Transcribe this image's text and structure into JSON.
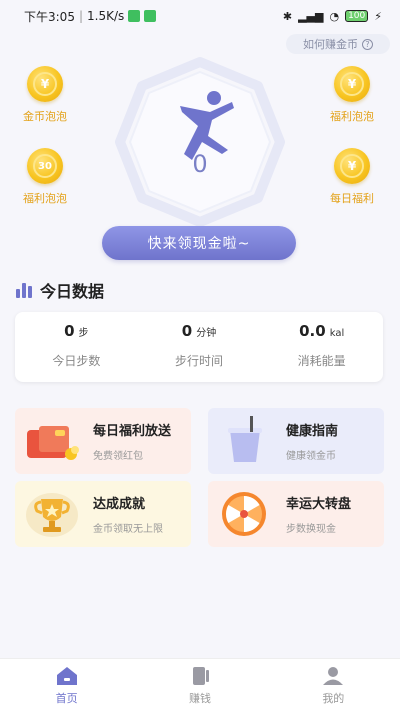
{
  "status_bar": {
    "time": "下午3:05",
    "network_speed": "1.5K/s",
    "battery": "100"
  },
  "help_link": "如何赚金币",
  "bubbles": {
    "left_top": {
      "label": "金币泡泡",
      "symbol": "¥"
    },
    "left_bottom": {
      "label": "福利泡泡",
      "symbol": "30"
    },
    "right_top": {
      "label": "福利泡泡",
      "symbol": "¥"
    },
    "right_bottom": {
      "label": "每日福利",
      "symbol": "¥"
    }
  },
  "step_counter": {
    "value": "0"
  },
  "collect_button": "快来领现金啦~",
  "today": {
    "title": "今日数据",
    "stats": [
      {
        "value": "0",
        "unit": "步",
        "label": "今日步数"
      },
      {
        "value": "0",
        "unit": "分钟",
        "label": "步行时间"
      },
      {
        "value": "0.0",
        "unit": "kal",
        "label": "消耗能量"
      }
    ]
  },
  "cards": [
    {
      "title": "每日福利放送",
      "subtitle": "免费领红包"
    },
    {
      "title": "健康指南",
      "subtitle": "健康领金币"
    },
    {
      "title": "达成成就",
      "subtitle": "金币领取无上限"
    },
    {
      "title": "幸运大转盘",
      "subtitle": "步数换现金"
    }
  ],
  "tabs": [
    {
      "label": "首页",
      "icon": "home-icon",
      "active": true
    },
    {
      "label": "赚钱",
      "icon": "earn-icon",
      "active": false
    },
    {
      "label": "我的",
      "icon": "profile-icon",
      "active": false
    }
  ],
  "colors": {
    "accent": "#6f74cc",
    "coin": "#f8c521",
    "coin_label": "#e3a21a"
  }
}
